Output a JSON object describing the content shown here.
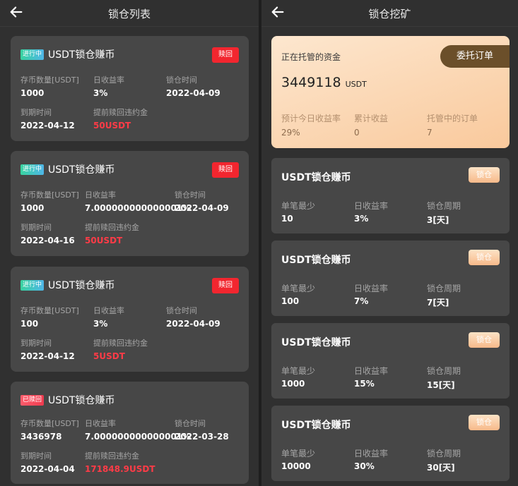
{
  "left": {
    "title": "锁仓列表",
    "cards": [
      {
        "status": "进行中",
        "status_type": "active",
        "title": "USDT锁仓赚币",
        "redeem_label": "赎回",
        "qty_label": "存币数量[USDT]",
        "qty": "1000",
        "rate_label": "日收益率",
        "rate": "3%",
        "lock_label": "锁仓时间",
        "lock": "2022-04-09",
        "expire_label": "到期时间",
        "expire": "2022-04-12",
        "penalty_label": "提前赎回违约金",
        "penalty": "50USDT"
      },
      {
        "status": "进行中",
        "status_type": "active",
        "title": "USDT锁仓赚币",
        "redeem_label": "赎回",
        "qty_label": "存币数量[USDT]",
        "qty": "1000",
        "rate_label": "日收益率",
        "rate": "7.000000000000001%",
        "lock_label": "锁仓时间",
        "lock": "2022-04-09",
        "expire_label": "到期时间",
        "expire": "2022-04-16",
        "penalty_label": "提前赎回违约金",
        "penalty": "50USDT"
      },
      {
        "status": "进行中",
        "status_type": "active",
        "title": "USDT锁仓赚币",
        "redeem_label": "赎回",
        "qty_label": "存币数量[USDT]",
        "qty": "100",
        "rate_label": "日收益率",
        "rate": "3%",
        "lock_label": "锁仓时间",
        "lock": "2022-04-09",
        "expire_label": "到期时间",
        "expire": "2022-04-12",
        "penalty_label": "提前赎回违约金",
        "penalty": "5USDT"
      },
      {
        "status": "已赎回",
        "status_type": "ended",
        "title": "USDT锁仓赚币",
        "qty_label": "存币数量[USDT]",
        "qty": "3436978",
        "rate_label": "日收益率",
        "rate": "7.000000000000001%",
        "lock_label": "锁仓时间",
        "lock": "2022-03-28",
        "expire_label": "到期时间",
        "expire": "2022-04-04",
        "penalty_label": "提前赎回违约金",
        "penalty": "171848.9USDT"
      }
    ]
  },
  "right": {
    "title": "锁仓挖矿",
    "hero": {
      "title": "正在托管的资金",
      "amount": "3449118",
      "unit": "USDT",
      "entrust_label": "委托订单",
      "stats": [
        {
          "label": "预计今日收益率",
          "value": "29%"
        },
        {
          "label": "累计收益",
          "value": "0"
        },
        {
          "label": "托管中的订单",
          "value": "7"
        }
      ]
    },
    "products": [
      {
        "title": "USDT锁仓赚币",
        "btn": "锁仓",
        "min_label": "单笔最少",
        "min": "10",
        "rate_label": "日收益率",
        "rate": "3%",
        "period_label": "锁仓周期",
        "period": "3[天]"
      },
      {
        "title": "USDT锁仓赚币",
        "btn": "锁仓",
        "min_label": "单笔最少",
        "min": "100",
        "rate_label": "日收益率",
        "rate": "7%",
        "period_label": "锁仓周期",
        "period": "7[天]"
      },
      {
        "title": "USDT锁仓赚币",
        "btn": "锁仓",
        "min_label": "单笔最少",
        "min": "1000",
        "rate_label": "日收益率",
        "rate": "15%",
        "period_label": "锁仓周期",
        "period": "15[天]"
      },
      {
        "title": "USDT锁仓赚币",
        "btn": "锁仓",
        "min_label": "单笔最少",
        "min": "10000",
        "rate_label": "日收益率",
        "rate": "30%",
        "period_label": "锁仓周期",
        "period": "30[天]"
      }
    ]
  },
  "colors": {
    "background": "#303030",
    "card": "#474747",
    "accent_red": "#f2262f",
    "value_red": "#ff3b47",
    "hero_gradient_start": "#fde7cf",
    "hero_gradient_end": "#f9c99c",
    "entrust_button": "#6b4f2a"
  },
  "icons": {
    "back": "arrow-left-icon"
  }
}
